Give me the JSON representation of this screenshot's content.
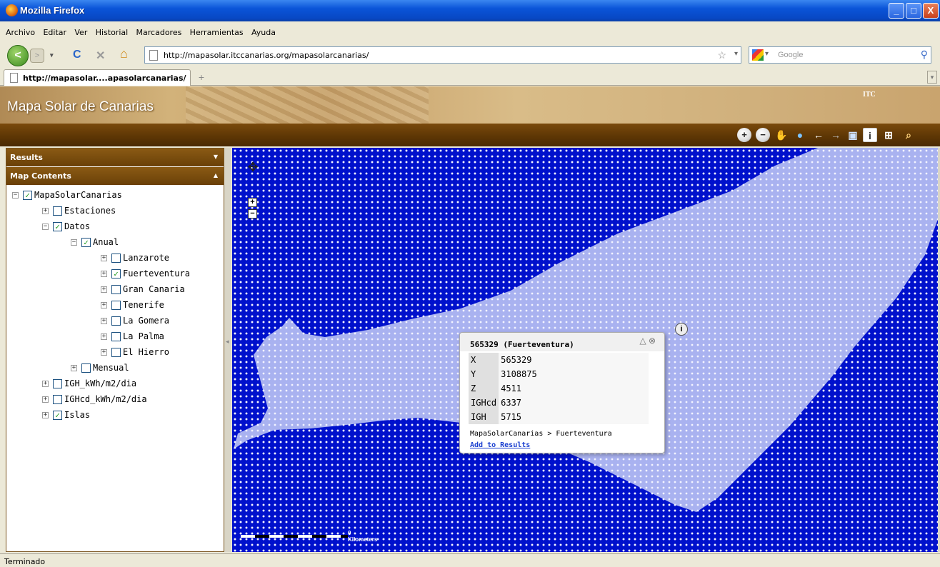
{
  "window": {
    "title": "Mozilla Firefox",
    "min": "_",
    "max": "□",
    "close": "X"
  },
  "menu": [
    "Archivo",
    "Editar",
    "Ver",
    "Historial",
    "Marcadores",
    "Herramientas",
    "Ayuda"
  ],
  "nav": {
    "back": "<",
    "fwd": ">",
    "reload": "C",
    "stop": "✕",
    "home": "⌂"
  },
  "url": {
    "value": "http://mapasolar.itccanarias.org/mapasolarcanarias/",
    "star": "☆",
    "dd": "▾"
  },
  "search": {
    "placeholder": "Google",
    "dd": "▾",
    "mag": "⚲"
  },
  "tabs": {
    "active": "http://mapasolar....apasolarcanarias/",
    "new": "+",
    "scroll": "▾"
  },
  "app": {
    "title": "Mapa Solar de Canarias",
    "logo": "ITC"
  },
  "toolbar": {
    "zoom_in": "+",
    "zoom_out": "−",
    "pan": "✋",
    "full_extent": "●",
    "prev": "←",
    "next": "→",
    "layers": "▣",
    "identify": "i",
    "measure": "⊞",
    "overview": "⌕"
  },
  "panels": {
    "results": {
      "title": "Results",
      "caret": "▼"
    },
    "contents": {
      "title": "Map Contents",
      "caret": "▲"
    }
  },
  "tree": [
    {
      "label": "MapaSolarCanarias",
      "level": 0,
      "checked": true,
      "expanded": true
    },
    {
      "label": "Estaciones",
      "level": 1,
      "checked": false,
      "expanded": false
    },
    {
      "label": "Datos",
      "level": 1,
      "checked": true,
      "expanded": true
    },
    {
      "label": "Anual",
      "level": 2,
      "checked": true,
      "expanded": true
    },
    {
      "label": "Lanzarote",
      "level": 3,
      "checked": false,
      "expanded": false
    },
    {
      "label": "Fuerteventura",
      "level": 3,
      "checked": true,
      "expanded": false
    },
    {
      "label": "Gran Canaria",
      "level": 3,
      "checked": false,
      "expanded": false
    },
    {
      "label": "Tenerife",
      "level": 3,
      "checked": false,
      "expanded": false
    },
    {
      "label": "La Gomera",
      "level": 3,
      "checked": false,
      "expanded": false
    },
    {
      "label": "La Palma",
      "level": 3,
      "checked": false,
      "expanded": false
    },
    {
      "label": "El Hierro",
      "level": 3,
      "checked": false,
      "expanded": false
    },
    {
      "label": "Mensual",
      "level": 2,
      "checked": false,
      "expanded": false
    },
    {
      "label": "IGH_kWh/m2/dia",
      "level": 1,
      "checked": false,
      "expanded": false
    },
    {
      "label": "IGHcd_kWh/m2/dia",
      "level": 1,
      "checked": false,
      "expanded": false
    },
    {
      "label": "Islas",
      "level": 1,
      "checked": true,
      "expanded": false
    }
  ],
  "map": {
    "zoom_in": "+",
    "zoom_out": "−",
    "compass": "✥",
    "scale": "0 Kilometers",
    "info_pin": "i",
    "colors": {
      "sea": "#0011cc",
      "land": "#a9b2f0"
    }
  },
  "popup": {
    "title": "565329  (Fuerteventura)",
    "collapse": "△",
    "close": "⊗",
    "rows": [
      {
        "k": "X",
        "v": "565329"
      },
      {
        "k": "Y",
        "v": "3108875"
      },
      {
        "k": "Z",
        "v": "4511"
      },
      {
        "k": "IGHcd",
        "v": "6337"
      },
      {
        "k": "IGH",
        "v": "5715"
      }
    ],
    "path": "MapaSolarCanarias > Fuerteventura",
    "add": "Add to Results"
  },
  "status": "Terminado"
}
